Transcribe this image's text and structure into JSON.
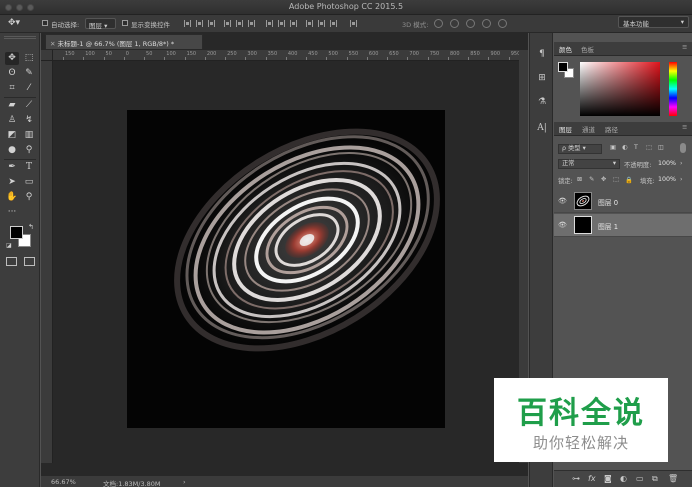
{
  "window": {
    "title": "Adobe Photoshop CC 2015.5"
  },
  "options_bar": {
    "auto_select_label": "自动选择:",
    "auto_select_target": "图层",
    "show_transform_label": "显示变换控件",
    "mode_3d_label": "3D 模式:",
    "workspace": "基本功能"
  },
  "document": {
    "tab_title": "未标题-1 @ 66.7% (图层 1, RGB/8*) *",
    "ruler_labels": [
      "150",
      "100",
      "50",
      "0",
      "50",
      "100",
      "150",
      "200",
      "250",
      "300",
      "350",
      "400",
      "450",
      "500",
      "550",
      "600",
      "650",
      "700",
      "750",
      "800",
      "850",
      "900",
      "950"
    ],
    "zoom": "66.67%",
    "doc_info": "文档:1.83M/3.80M"
  },
  "color_panel": {
    "tabs": [
      "颜色",
      "色板"
    ],
    "fg_color": "#000000",
    "bg_color": "#ffffff"
  },
  "layers_panel": {
    "tabs": [
      "图层",
      "通道",
      "路径"
    ],
    "filter_kind": "ρ 类型",
    "blend_mode": "正常",
    "opacity_label": "不透明度:",
    "opacity_value": "100%",
    "lock_label": "锁定:",
    "fill_label": "填充:",
    "fill_value": "100%",
    "layers": [
      {
        "name": "图层 0",
        "selected": false
      },
      {
        "name": "图层 1",
        "selected": true
      }
    ],
    "footer_icons": [
      "link-icon",
      "fx-icon",
      "mask-icon",
      "adjustment-icon",
      "group-icon",
      "new-layer-icon",
      "trash-icon"
    ]
  },
  "toolbar": {
    "tools": [
      "move-tool-icon",
      "marquee-tool-icon",
      "lasso-tool-icon",
      "quick-select-tool-icon",
      "crop-tool-icon",
      "eyedropper-tool-icon",
      "healing-brush-icon",
      "brush-tool-icon",
      "stamp-tool-icon",
      "history-brush-icon",
      "eraser-tool-icon",
      "gradient-tool-icon",
      "blur-tool-icon",
      "dodge-tool-icon",
      "pen-tool-icon",
      "type-tool-icon",
      "path-select-tool-icon",
      "rectangle-tool-icon",
      "hand-tool-icon",
      "zoom-tool-icon"
    ]
  },
  "watermark": {
    "main": "百科全说",
    "sub": "助你轻松解决"
  }
}
